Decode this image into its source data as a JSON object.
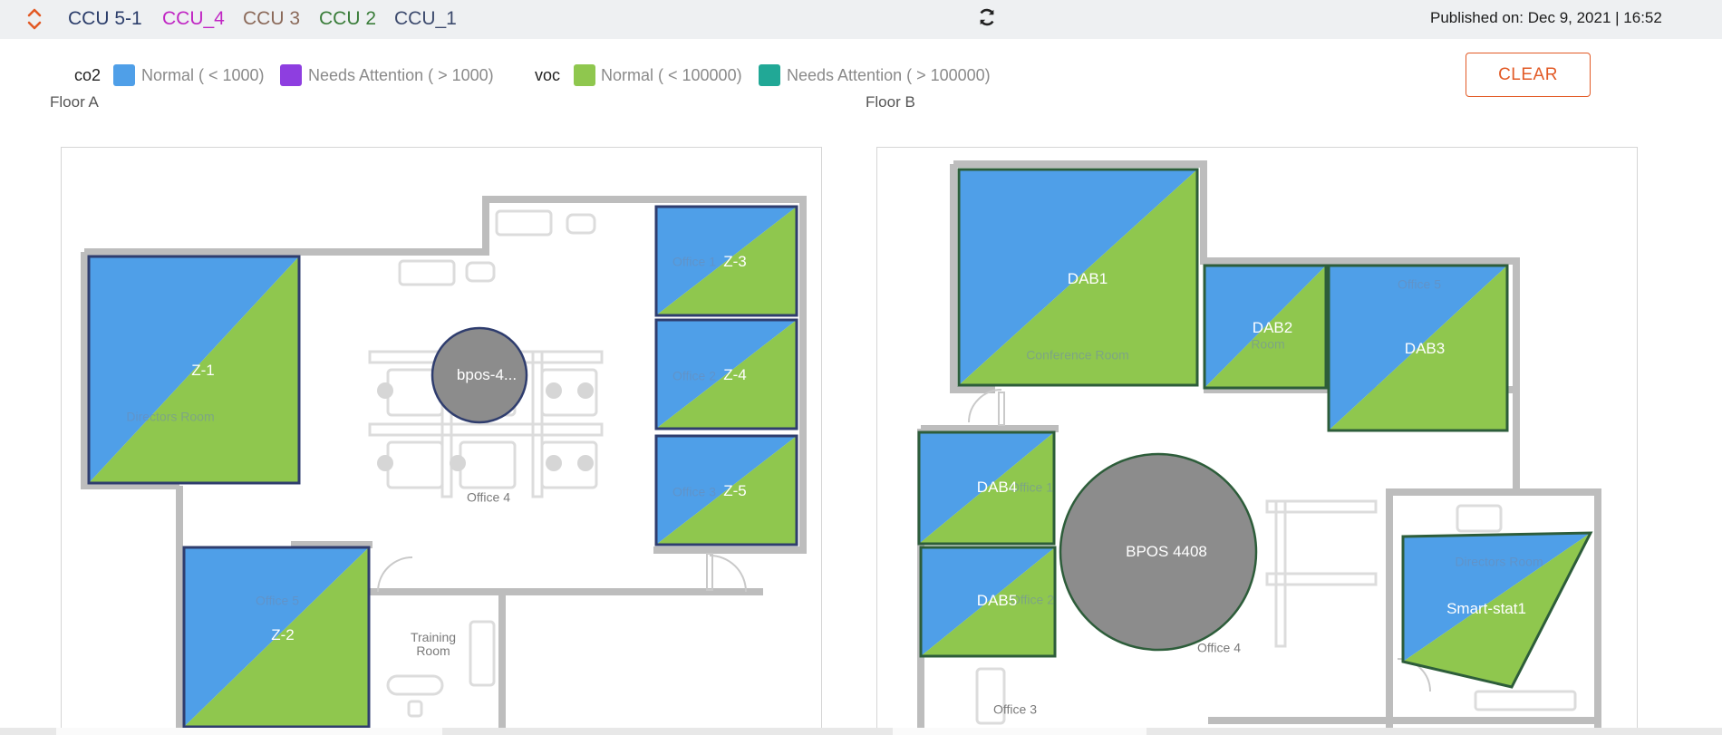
{
  "header": {
    "ccu_tabs": [
      {
        "label": "CCU 5-1",
        "color": "#2c3e6b"
      },
      {
        "label": "CCU_4",
        "color": "#c026c4"
      },
      {
        "label": "CCU 3",
        "color": "#8b6a5a"
      },
      {
        "label": "CCU 2",
        "color": "#3a7d3a"
      },
      {
        "label": "CCU_1",
        "color": "#3d4b6e"
      }
    ],
    "published": "Published on: Dec 9, 2021 | 16:52",
    "sort_icon": "sort-up-down-icon",
    "refresh_icon": "refresh-icon"
  },
  "legend": {
    "co2_key": "co2",
    "co2_normal": {
      "label": "Normal ( < 1000)",
      "color": "#4f9fe8"
    },
    "co2_attention": {
      "label": "Needs Attention ( > 1000)",
      "color": "#8e3ee0"
    },
    "voc_key": "voc",
    "voc_normal": {
      "label": "Normal ( < 100000)",
      "color": "#8fc74e"
    },
    "voc_attention": {
      "label": "Needs Attention ( > 100000)",
      "color": "#21a896"
    }
  },
  "clear_button": "CLEAR",
  "floor_a": {
    "title": "Floor A",
    "zones": [
      "Z-1",
      "Z-2",
      "Z-3",
      "Z-4",
      "Z-5"
    ],
    "bpos": "bpos-4...",
    "rooms": {
      "directors": "Directors Room",
      "office4": "Office 4",
      "office5": "Office 5",
      "office1": "Office 1",
      "office2": "Office 2",
      "office3": "Office 3",
      "training": "Training Room"
    }
  },
  "floor_b": {
    "title": "Floor B",
    "zones": [
      "DAB1",
      "DAB2",
      "DAB3",
      "DAB4",
      "DAB5",
      "Smart-stat1"
    ],
    "bpos": "BPOS 4408",
    "rooms": {
      "conference": "Conference Room",
      "office4": "Office 4",
      "office3": "Office 3",
      "office5": "Office 5",
      "directors": "Directors Room",
      "office1": "Office 1",
      "office2": "Office 2",
      "room": "Room"
    }
  },
  "colors": {
    "co2_normal": "#4f9fe8",
    "voc_normal": "#8fc74e",
    "wall": "#b9b9b9",
    "bpos_fill": "#8c8c8c"
  }
}
